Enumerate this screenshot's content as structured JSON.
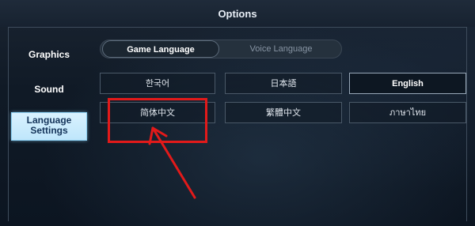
{
  "window": {
    "title": "Options"
  },
  "sidebar": {
    "items": [
      {
        "label": "Graphics"
      },
      {
        "label": "Sound"
      },
      {
        "label": "Language Settings",
        "line1": "Language",
        "line2": "Settings",
        "active": true
      }
    ]
  },
  "tabs": [
    {
      "label": "Game Language",
      "active": true
    },
    {
      "label": "Voice Language",
      "active": false
    }
  ],
  "languages": [
    {
      "label": "한국어"
    },
    {
      "label": "日本語"
    },
    {
      "label": "English",
      "selected": true
    },
    {
      "label": "简体中文"
    },
    {
      "label": "繁體中文"
    },
    {
      "label": "ภาษาไทย"
    }
  ],
  "annotation": {
    "color": "#e21a1a",
    "target": "简体中文"
  }
}
